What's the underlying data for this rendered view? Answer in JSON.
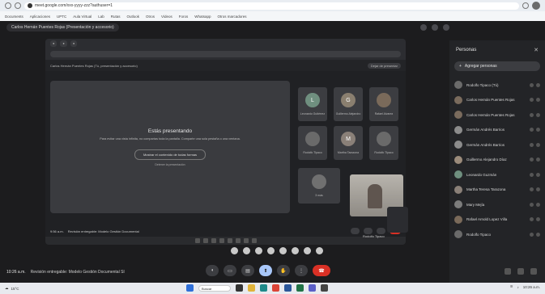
{
  "browser": {
    "url": "meet.google.com/xxx-yyyy-zzz?authuser=1",
    "bookmarks": [
      "Documents",
      "Aplicaciones",
      "UPTC",
      "Aula Virtual",
      "Lab",
      "Rutas",
      "Outlook",
      "Otros",
      "Videos",
      "Foros",
      "Whatsapp",
      "Otros marcadores"
    ]
  },
  "meeting": {
    "title": "Carlos Hernán Puentes Rojas (Presentación y accesorio)",
    "time": "10:26 a.m.",
    "name": "Revisión entregable: Modelo Gestión Documental SI"
  },
  "shared": {
    "title": "Carlos Hernán Puentes Rojas (Tú, presentación y accesorio)",
    "stop_label": "Dejar de presentar",
    "presenting_title": "Estás presentando",
    "presenting_desc": "Para evitar una vista infinita, no compartas toda la pantalla. Comparte una sola pestaña o una ventana.",
    "show_button": "Mostrar el contenido de todas formas",
    "stop_link": "Detener la presentación",
    "time": "9:56 a.m.",
    "name": "Revisión entregable: Modelo Gestión Documental"
  },
  "tiles": [
    {
      "initial": "L",
      "name": "Leonardo Gutiérrez",
      "color": "#6f8f7f"
    },
    {
      "initial": "G",
      "name": "Guillermo Alejandro",
      "color": "#8a7f6f"
    },
    {
      "initial": "",
      "name": "Rafael Alvarez",
      "color": "#7a6a5a"
    },
    {
      "initial": "",
      "name": "Rodolfo Tipaco",
      "color": "#6a6a6a"
    },
    {
      "initial": "M",
      "name": "Martha Tarazona",
      "color": "#8a8078"
    },
    {
      "initial": "",
      "name": "Rodolfo Tipaco",
      "color": "#6a6a6a"
    },
    {
      "initial": "",
      "name": "3 más",
      "color": "#707070"
    }
  ],
  "presenter_label": "Rodolfo Tipaco",
  "people": {
    "title": "Personas",
    "add_label": "Agregar personas",
    "list": [
      {
        "name": "Rodolfo Tipaco (Tú)",
        "color": "#6b6b6b"
      },
      {
        "name": "Carlos Hernán Puentes Rojas",
        "color": "#7a6b5d"
      },
      {
        "name": "Carlos Hernán Puentes Rojas",
        "color": "#7a6b5d"
      },
      {
        "name": "Germán Andrés Barrios",
        "color": "#8c8c8c"
      },
      {
        "name": "Germán Andrés Barrios",
        "color": "#8c8c8c"
      },
      {
        "name": "Guillermo Alejandro Díaz",
        "color": "#9b8b7b"
      },
      {
        "name": "Leonardo Guzmán",
        "color": "#6f8f7f"
      },
      {
        "name": "Martha Teresa Tarazona",
        "color": "#8a8078"
      },
      {
        "name": "Mary Mejía",
        "color": "#7c7c7c"
      },
      {
        "name": "Rafael Arnold Lopez Villa",
        "color": "#7a6a5a"
      },
      {
        "name": "Rodolfo Tipaco",
        "color": "#6a6a6a"
      }
    ]
  },
  "taskbar": {
    "weather": "15°C",
    "search_placeholder": "Buscar",
    "clock": "10:26 a.m."
  }
}
